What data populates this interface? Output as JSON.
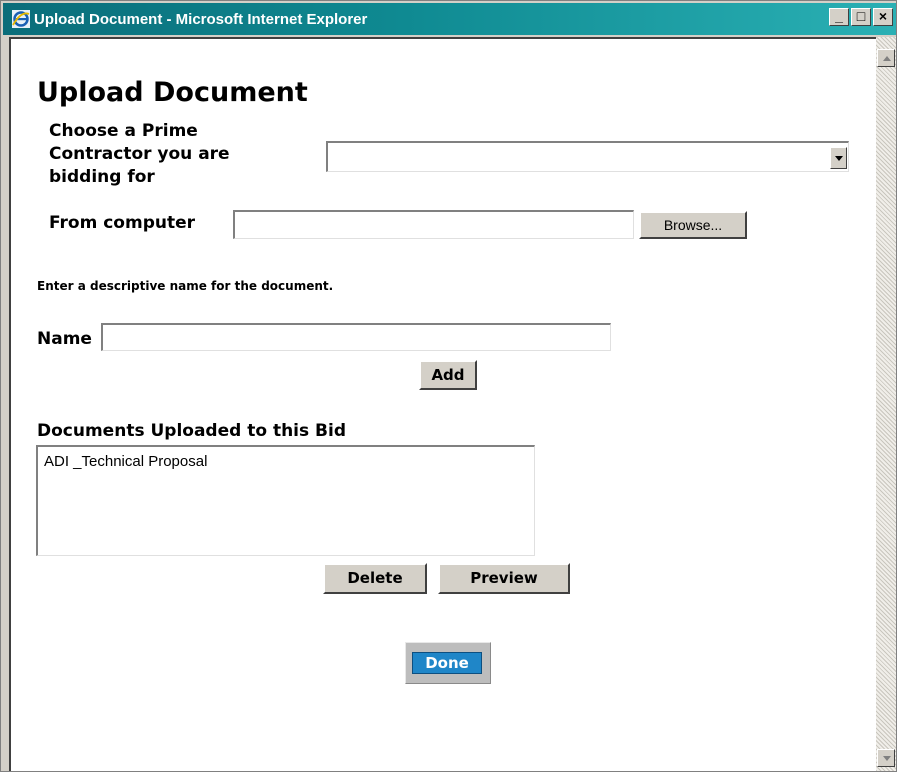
{
  "window": {
    "title": "Upload Document - Microsoft Internet Explorer",
    "icon": "internet-explorer-icon",
    "controls": {
      "minimize": "_",
      "maximize": "□",
      "close": "×"
    }
  },
  "page": {
    "heading": "Upload Document",
    "prime_contractor": {
      "label_line1": "Choose a Prime",
      "label_line2": "Contractor you are",
      "label_line3": "bidding for",
      "selected": ""
    },
    "from_computer": {
      "label": "From computer",
      "value": "",
      "browse_label": "Browse..."
    },
    "description_hint": "Enter a descriptive name for the document.",
    "name_field": {
      "label": "Name",
      "value": ""
    },
    "add_label": "Add",
    "documents": {
      "heading": "Documents Uploaded to this Bid",
      "items": [
        "ADI _Technical Proposal"
      ]
    },
    "delete_label": "Delete",
    "preview_label": "Preview",
    "done_label": "Done"
  },
  "colors": {
    "titlebar_start": "#0a6d7a",
    "titlebar_end": "#2ab0b4",
    "done_button": "#1f86c8",
    "button_face": "#d4d0c8"
  }
}
